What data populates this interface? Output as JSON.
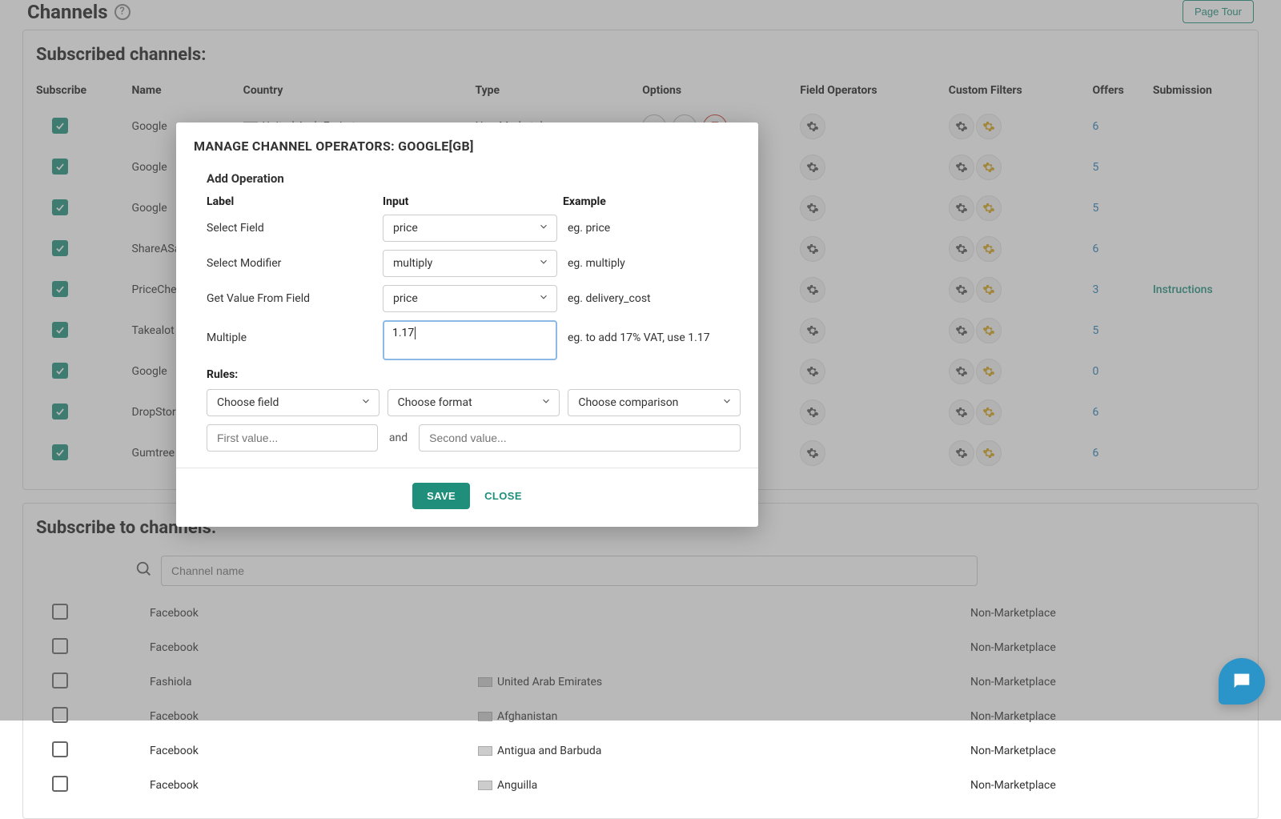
{
  "header": {
    "title": "Channels",
    "page_tour": "Page Tour"
  },
  "subscribed": {
    "title": "Subscribed channels:",
    "columns": {
      "subscribe": "Subscribe",
      "name": "Name",
      "country": "Country",
      "type": "Type",
      "options": "Options",
      "field_operators": "Field Operators",
      "custom_filters": "Custom Filters",
      "offers": "Offers",
      "submission": "Submission"
    },
    "rows": [
      {
        "name": "Google",
        "country": "United Arab Emirates",
        "type": "Non-Marketplace",
        "offers": "6",
        "submission": ""
      },
      {
        "name": "Google",
        "country": "",
        "type": "",
        "offers": "5",
        "submission": ""
      },
      {
        "name": "Google",
        "country": "",
        "type": "",
        "offers": "5",
        "submission": ""
      },
      {
        "name": "ShareASale",
        "country": "",
        "type": "",
        "offers": "6",
        "submission": ""
      },
      {
        "name": "PriceCheck",
        "country": "",
        "type": "",
        "offers": "3",
        "submission": "Instructions"
      },
      {
        "name": "Takealot",
        "country": "",
        "type": "",
        "offers": "5",
        "submission": ""
      },
      {
        "name": "Google",
        "country": "",
        "type": "",
        "offers": "0",
        "submission": ""
      },
      {
        "name": "DropStore",
        "country": "",
        "type": "",
        "offers": "6",
        "submission": ""
      },
      {
        "name": "Gumtree",
        "country": "",
        "type": "",
        "offers": "6",
        "submission": ""
      }
    ]
  },
  "available": {
    "title": "Subscribe to channels:",
    "search_placeholder": "Channel name",
    "rows": [
      {
        "name": "Facebook",
        "country": "",
        "type": "Non-Marketplace"
      },
      {
        "name": "Facebook",
        "country": "",
        "type": "Non-Marketplace"
      },
      {
        "name": "Fashiola",
        "country": "United Arab Emirates",
        "type": "Non-Marketplace"
      },
      {
        "name": "Facebook",
        "country": "Afghanistan",
        "type": "Non-Marketplace"
      },
      {
        "name": "Facebook",
        "country": "Antigua and Barbuda",
        "type": "Non-Marketplace"
      },
      {
        "name": "Facebook",
        "country": "Anguilla",
        "type": "Non-Marketplace"
      }
    ]
  },
  "modal": {
    "title": "MANAGE CHANNEL OPERATORS: GOOGLE[GB]",
    "add_op": "Add Operation",
    "head": {
      "label": "Label",
      "input": "Input",
      "example": "Example"
    },
    "rows": {
      "select_field": {
        "label": "Select Field",
        "value": "price",
        "eg": "eg. price"
      },
      "select_modifier": {
        "label": "Select Modifier",
        "value": "multiply",
        "eg": "eg. multiply"
      },
      "get_value": {
        "label": "Get Value From Field",
        "value": "price",
        "eg": "eg. delivery_cost"
      },
      "multiple": {
        "label": "Multiple",
        "value": "1.17",
        "eg": "eg. to add 17% VAT, use 1.17"
      }
    },
    "rules": {
      "title": "Rules:",
      "choose_field": "Choose field",
      "choose_format": "Choose format",
      "choose_comparison": "Choose comparison",
      "first_value": "First value...",
      "and": "and",
      "second_value": "Second value..."
    },
    "actions": {
      "save": "SAVE",
      "close": "CLOSE"
    }
  }
}
